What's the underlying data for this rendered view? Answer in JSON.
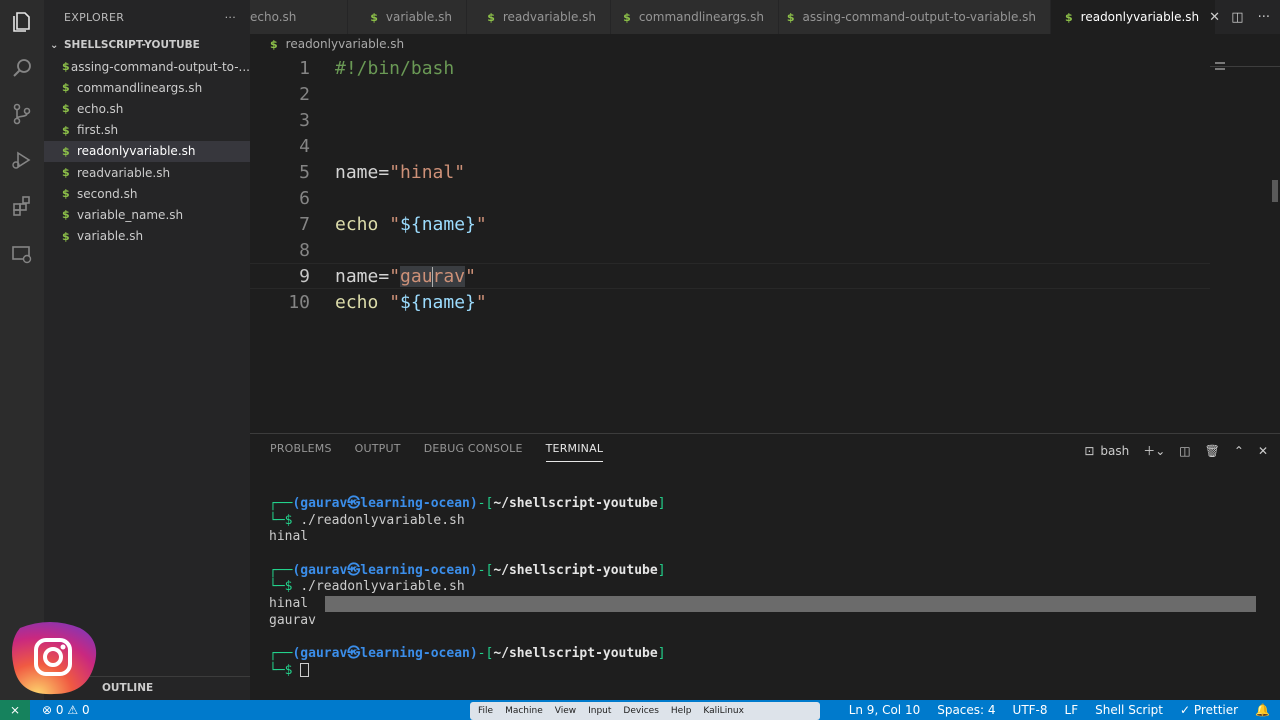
{
  "sidebar": {
    "title": "EXPLORER",
    "folder": "SHELLSCRIPT-YOUTUBE",
    "files": [
      {
        "name": "assing-command-output-to-..."
      },
      {
        "name": "commandlineargs.sh"
      },
      {
        "name": "echo.sh"
      },
      {
        "name": "first.sh"
      },
      {
        "name": "readonlyvariable.sh"
      },
      {
        "name": "readvariable.sh"
      },
      {
        "name": "second.sh"
      },
      {
        "name": "variable_name.sh"
      },
      {
        "name": "variable.sh"
      }
    ],
    "outline": "OUTLINE"
  },
  "tabs": [
    {
      "label": "echo.sh"
    },
    {
      "label": "variable.sh"
    },
    {
      "label": "readvariable.sh"
    },
    {
      "label": "commandlineargs.sh"
    },
    {
      "label": "assing-command-output-to-variable.sh"
    },
    {
      "label": "readonlyvariable.sh"
    }
  ],
  "breadcrumb": "readonlyvariable.sh",
  "editor": {
    "line_numbers": [
      "1",
      "2",
      "3",
      "4",
      "5",
      "6",
      "7",
      "8",
      "9",
      "10"
    ],
    "line1": "#!/bin/bash",
    "line5_var": "name=",
    "line5_str": "\"hinal\"",
    "line7_cmd": "echo ",
    "line7_q1": "\"",
    "line7_var": "${name}",
    "line7_q2": "\"",
    "line9_var": "name=",
    "line9_q1": "\"",
    "line9_sel1": "gau",
    "line9_sel2": "rav",
    "line9_q2": "\"",
    "line10_cmd": "echo ",
    "line10_q1": "\"",
    "line10_var": "${name}",
    "line10_q2": "\""
  },
  "panel": {
    "tabs": [
      "PROBLEMS",
      "OUTPUT",
      "DEBUG CONSOLE",
      "TERMINAL"
    ],
    "shell": "bash"
  },
  "terminal": {
    "prompt_user": "(gaurav㉿learning-ocean)",
    "prompt_sep": "-[",
    "prompt_path": "~/shellscript-youtube",
    "prompt_end": "]",
    "prompt_tail": "└─$ ",
    "prompt_head": "┌──",
    "cmd": "./readonlyvariable.sh",
    "out1": "hinal",
    "out2": "gaurav"
  },
  "status": {
    "errors": "0",
    "warnings": "0",
    "position": "Ln 9, Col 10",
    "spaces": "Spaces: 4",
    "encoding": "UTF-8",
    "eol": "LF",
    "language": "Shell Script",
    "prettier": "Prettier"
  },
  "vm_menu": [
    "File",
    "Machine",
    "View",
    "Input",
    "Devices",
    "Help",
    "KaliLinux"
  ]
}
